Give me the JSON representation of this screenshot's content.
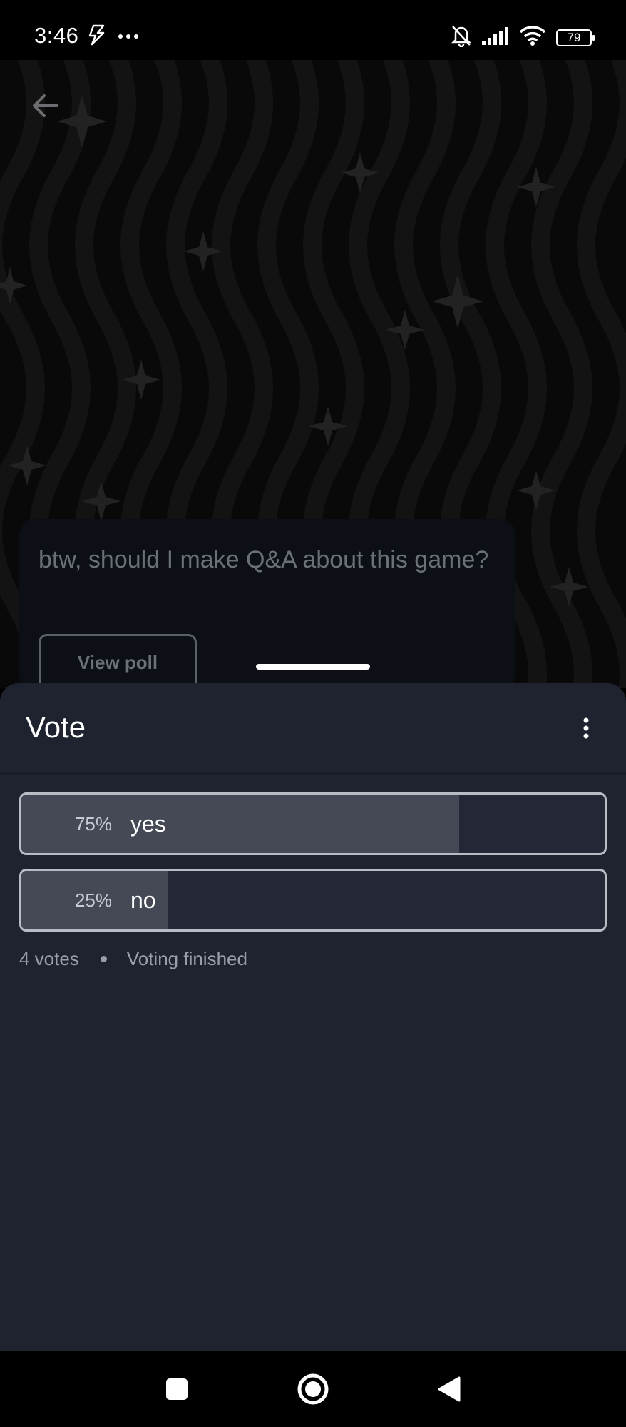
{
  "status_bar": {
    "time": "3:46",
    "left_icons": [
      "flash-notification-icon",
      "more-dots-icon"
    ],
    "right_icons": [
      "bell-off-icon",
      "signal-icon",
      "wifi-icon"
    ],
    "battery": "79"
  },
  "background_post": {
    "text": "btw, should I make Q&A about this game?",
    "view_poll_label": "View poll"
  },
  "sheet": {
    "title": "Vote",
    "options": [
      {
        "percent_label": "75%",
        "label": "yes",
        "fraction": 0.75
      },
      {
        "percent_label": "25%",
        "label": "no",
        "fraction": 0.25
      }
    ],
    "votes": "4 votes",
    "status": "Voting finished"
  },
  "nav_bar": {
    "buttons": [
      "recents-square-icon",
      "home-circle-icon",
      "back-triangle-icon"
    ]
  },
  "colors": {
    "sheet_bg": "#1f2330",
    "option_fill": "#454955",
    "option_border": "#b9bcc5",
    "muted_text": "#9a9ea8"
  }
}
